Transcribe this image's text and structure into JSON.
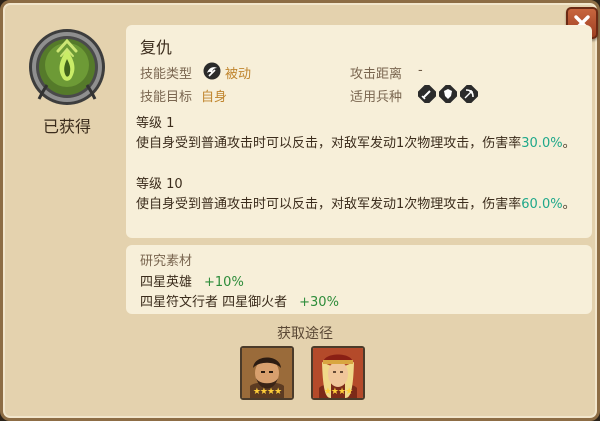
{
  "skill": {
    "name": "复仇",
    "obtained_label": "已获得",
    "type_label": "技能类型",
    "type_value": "被动",
    "range_label": "攻击距离",
    "range_value": "-",
    "target_label": "技能目标",
    "target_value": "自身",
    "troops_label": "适用兵种",
    "troop_icons": [
      "sword-icon",
      "shield-icon",
      "bow-icon"
    ]
  },
  "levels": [
    {
      "label": "等级 1",
      "desc_before": "使自身受到普通攻击时可以反击，对敌军发动1次物理攻击，伤害率",
      "desc_pct": "30.0%",
      "desc_after": "。"
    },
    {
      "label": "等级 10",
      "desc_before": "使自身受到普通攻击时可以反击，对敌军发动1次物理攻击，伤害率",
      "desc_pct": "60.0%",
      "desc_after": "。"
    }
  ],
  "materials": {
    "title": "研究素材",
    "lines": [
      {
        "names": "四星英雄",
        "bonus": "+10%"
      },
      {
        "names": "四星符文行者 四星御火者",
        "bonus": "+30%"
      }
    ]
  },
  "sources": {
    "title": "获取途径",
    "heroes": [
      {
        "stars": "★★★★"
      },
      {
        "stars": "★★★★"
      }
    ]
  },
  "colors": {
    "accent": "#c0852e",
    "percent": "#1fa88a",
    "bonus": "#2d8c3a",
    "close_button": "#b4512f"
  }
}
